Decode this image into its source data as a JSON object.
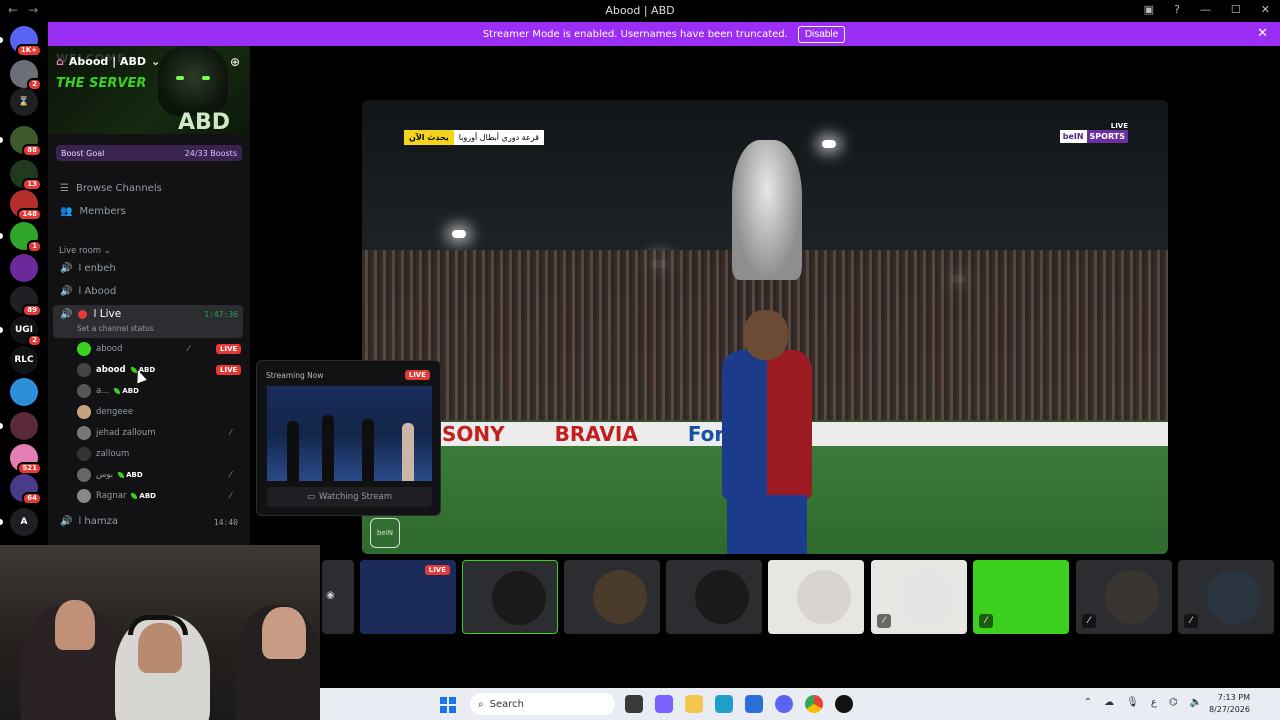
{
  "window": {
    "back_glyph": "←",
    "forward_glyph": "→",
    "title": "Abood | ABD",
    "controls": [
      "▣",
      "?",
      "—",
      "☐",
      "✕"
    ]
  },
  "banner": {
    "text": "Streamer Mode is enabled. Usernames have been truncated.",
    "button_label": "Disable",
    "close_glyph": "✕"
  },
  "guilds": [
    {
      "label": "",
      "color": "#5865f2",
      "badge": "1K+"
    },
    {
      "label": "",
      "color": "#6d6f78",
      "badge": "2"
    },
    {
      "label": "⌛",
      "color": "#1e1f22",
      "badge": ""
    },
    {
      "label": "",
      "color": "#3d5a2a",
      "badge": "88"
    },
    {
      "label": "",
      "color": "#1f3a1f",
      "badge": "13"
    },
    {
      "label": "",
      "color": "#b52e2e",
      "badge": "148"
    },
    {
      "label": "",
      "color": "#2fa52a",
      "badge": "1"
    },
    {
      "label": "",
      "color": "#6a2a9c",
      "badge": ""
    },
    {
      "label": "",
      "color": "#1e1f22",
      "badge": "89"
    },
    {
      "label": "UGI",
      "color": "#111214",
      "badge": "2"
    },
    {
      "label": "RLC",
      "color": "#111214",
      "badge": ""
    },
    {
      "label": "",
      "color": "#2a8fd6",
      "badge": ""
    },
    {
      "label": "",
      "color": "#5a2a3a",
      "badge": ""
    },
    {
      "label": "",
      "color": "#e57db5",
      "badge": "521"
    },
    {
      "label": "",
      "color": "#4a3a8a",
      "badge": "64"
    },
    {
      "label": "A",
      "color": "#1e1f22",
      "badge": ""
    }
  ],
  "server": {
    "name": "Abood | ABD",
    "banner_welcome": "WELCOME",
    "banner_server": "THE SERVER",
    "banner_abd": "ABD",
    "boost_label": "Boost Goal",
    "boost_progress": "24/33 Boosts",
    "browse_channels": "Browse Channels",
    "members": "Members",
    "category": "Live room",
    "voice_channels": [
      {
        "name": "ا enbeh"
      },
      {
        "name": "ا Abood"
      }
    ],
    "live_channel": {
      "name": "ا Live",
      "timer": "1:47:36",
      "status_placeholder": "Set a channel status"
    },
    "users": [
      {
        "name": "abood",
        "tag": "",
        "live": "LIVE",
        "avatar": "#3bd11e"
      },
      {
        "name": "abood",
        "tag": "ABD",
        "live": "LIVE",
        "avatar": "#444"
      },
      {
        "name": "a...",
        "tag": "ABD",
        "live": "",
        "avatar": "#555"
      },
      {
        "name": "dengeee",
        "tag": "",
        "live": "",
        "avatar": "#c7a27a"
      },
      {
        "name": "jehad zalloum",
        "tag": "",
        "live": "",
        "avatar": "#777"
      },
      {
        "name": "zalloum",
        "tag": "",
        "live": "",
        "avatar": "#333"
      },
      {
        "name": "بوس",
        "tag": "ABD",
        "live": "",
        "avatar": "#666"
      },
      {
        "name": "Ragnar",
        "tag": "ABD",
        "live": "",
        "avatar": "#888"
      }
    ],
    "hamza": {
      "name": "ا hamza",
      "timer": "14:40"
    }
  },
  "video": {
    "update_now": "يحدث الآن",
    "match_title": "قرعة دوري أبطال أوروبا",
    "live_label": "LIVE",
    "channel_brand": "beIN",
    "channel_sports": "SPORTS",
    "ads": [
      "SONY",
      "BRAVIA",
      "Ford"
    ],
    "corner_logo": "beIN"
  },
  "popup": {
    "header": "Streaming Now",
    "live": "LIVE",
    "watch_label": "Watching Stream"
  },
  "tiles": [
    {
      "live": "LIVE",
      "color": "#1b2b5a"
    },
    {
      "live": "",
      "color": "#1a1a1a"
    },
    {
      "live": "",
      "color": "#4a3a2a"
    },
    {
      "live": "",
      "color": "#1a1a1a"
    },
    {
      "live": "",
      "color": "#d8d4cf"
    },
    {
      "live": "",
      "color": "#e5e5e5"
    },
    {
      "live": "",
      "color": "#3bd11e"
    },
    {
      "live": "",
      "color": "#3a3430"
    },
    {
      "live": "",
      "color": "#2a3540"
    }
  ],
  "taskbar": {
    "search_label": "Search",
    "time": "7:13 PM",
    "date": "8/27/2026",
    "tray_lang": "ع"
  }
}
